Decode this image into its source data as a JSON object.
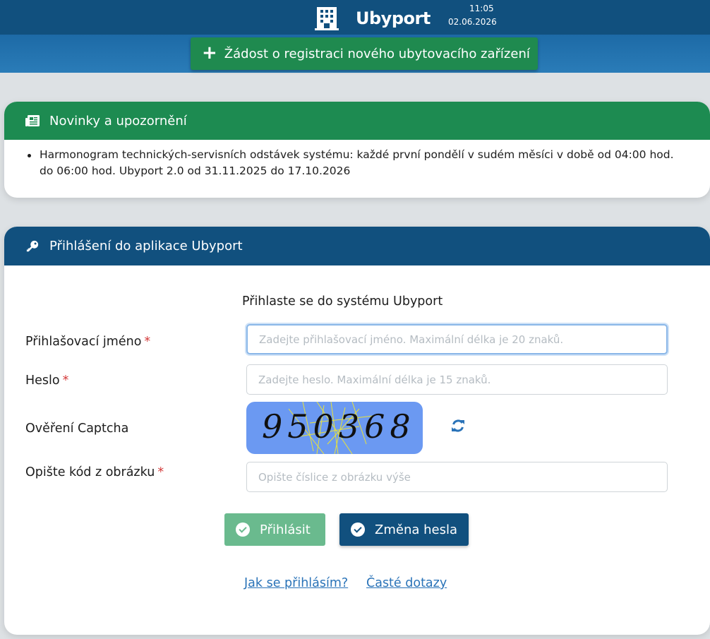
{
  "header": {
    "brand": "Ubyport",
    "time": "11:05",
    "date": "02.06.2026",
    "brand_icon": "building-icon"
  },
  "register_button": {
    "label": "Žádost o registraci nového ubytovacího zařízení",
    "icon": "plus-icon"
  },
  "news": {
    "title": "Novinky a upozornění",
    "icon": "newspaper-icon",
    "items": [
      "Harmonogram technických-servisních odstávek systému: každé první pondělí v sudém měsíci v době od 04:00 hod. do 06:00 hod. Ubyport 2.0 od 31.11.2025 do 17.10.2026"
    ]
  },
  "login": {
    "title": "Přihlášení do aplikace Ubyport",
    "icon": "key-icon",
    "subtitle": "Přihlaste se do systému Ubyport",
    "username_label": "Přihlašovací jméno",
    "username_placeholder": "Zadejte přihlašovací jméno. Maximální délka je 20 znaků.",
    "password_label": "Heslo",
    "password_placeholder": "Zadejte heslo. Maximální délka je 15 znaků.",
    "captcha_label": "Ověření Captcha",
    "captcha_code": "950368",
    "code_label": "Opište kód z obrázku",
    "code_placeholder": "Opište číslice z obrázku výše",
    "required_mark": "*",
    "login_button": "Přihlásit",
    "change_password_button": "Změna hesla",
    "help_link": "Jak se přihlásím?",
    "faq_link": "Časté dotazy"
  },
  "colors": {
    "topbar": "#11507e",
    "green": "#1d8b51",
    "link": "#2a73b8",
    "required": "#d43b3b"
  }
}
